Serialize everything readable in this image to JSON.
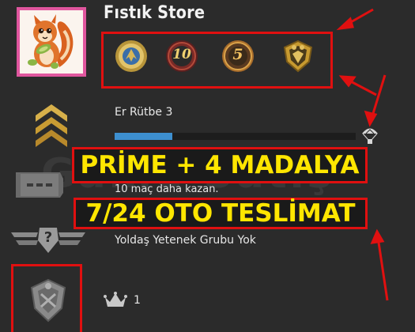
{
  "store": {
    "title": "Fıstık Store"
  },
  "rank": {
    "label": "Er Rütbe 3",
    "xp_progress": 0.24
  },
  "promo": {
    "line1": "PRİME + 4 MADALYA",
    "line2": "7/24 OTO TESLİMAT"
  },
  "watermark": "Game Satış",
  "wins": {
    "text": "10 maç daha kazan."
  },
  "skill_group": {
    "placeholder_mark": "?",
    "text": "Yoldaş Yetenek Grubu Yok"
  },
  "medals": [
    {
      "name": "blue-emblem-medal",
      "text": ""
    },
    {
      "name": "ten-year-coin",
      "text": "10"
    },
    {
      "name": "five-year-coin",
      "text": "5"
    },
    {
      "name": "shield-badge",
      "text": ""
    }
  ],
  "profile": {
    "crown_count": "1"
  },
  "colors": {
    "highlight_red": "#e01010",
    "promo_yellow": "#ffe600",
    "xp_blue": "#3d8fd0",
    "background": "#2b2b2b"
  }
}
